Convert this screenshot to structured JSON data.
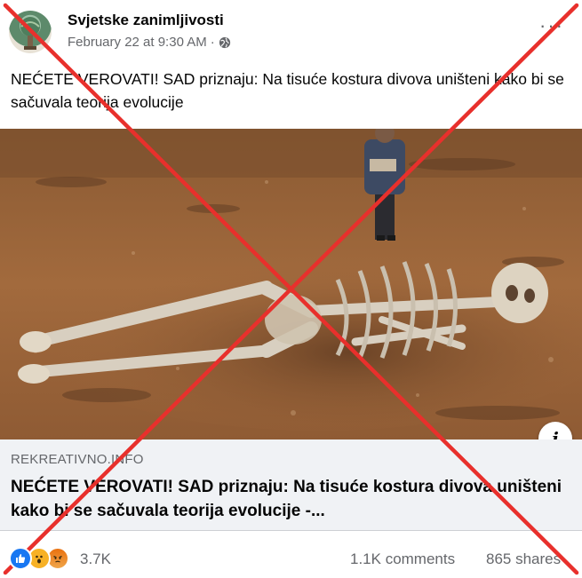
{
  "post": {
    "author": "Svjetske zanimljivosti",
    "timestamp": "February 22 at 9:30 AM",
    "separator": "·",
    "audience_icon": "globe-icon",
    "more_icon": "more-options-icon",
    "more_glyph": "···",
    "text": "NEĆETE VEROVATI! SAD priznaju: Na tisuće kostura divova uništeni kako bi se sačuvala teorija evolucije"
  },
  "link_preview": {
    "domain": "REKREATIVNO.INFO",
    "title": "NEĆETE VEROVATI! SAD priznaju: Na tisuće kostura divova uništeni kako bi se sačuvala teorija evolucije -...",
    "info_icon": "info-icon",
    "info_glyph": "i"
  },
  "engagement": {
    "reactions": [
      "like",
      "wow",
      "angry"
    ],
    "reaction_count": "3.7K",
    "comments": "1.1K comments",
    "shares": "865 shares"
  },
  "overlay": {
    "type": "red-x",
    "color": "#e8302c"
  },
  "colors": {
    "text_primary": "#050505",
    "text_secondary": "#65676b",
    "card_bg": "#f0f2f5",
    "like_blue": "#1877f2"
  }
}
